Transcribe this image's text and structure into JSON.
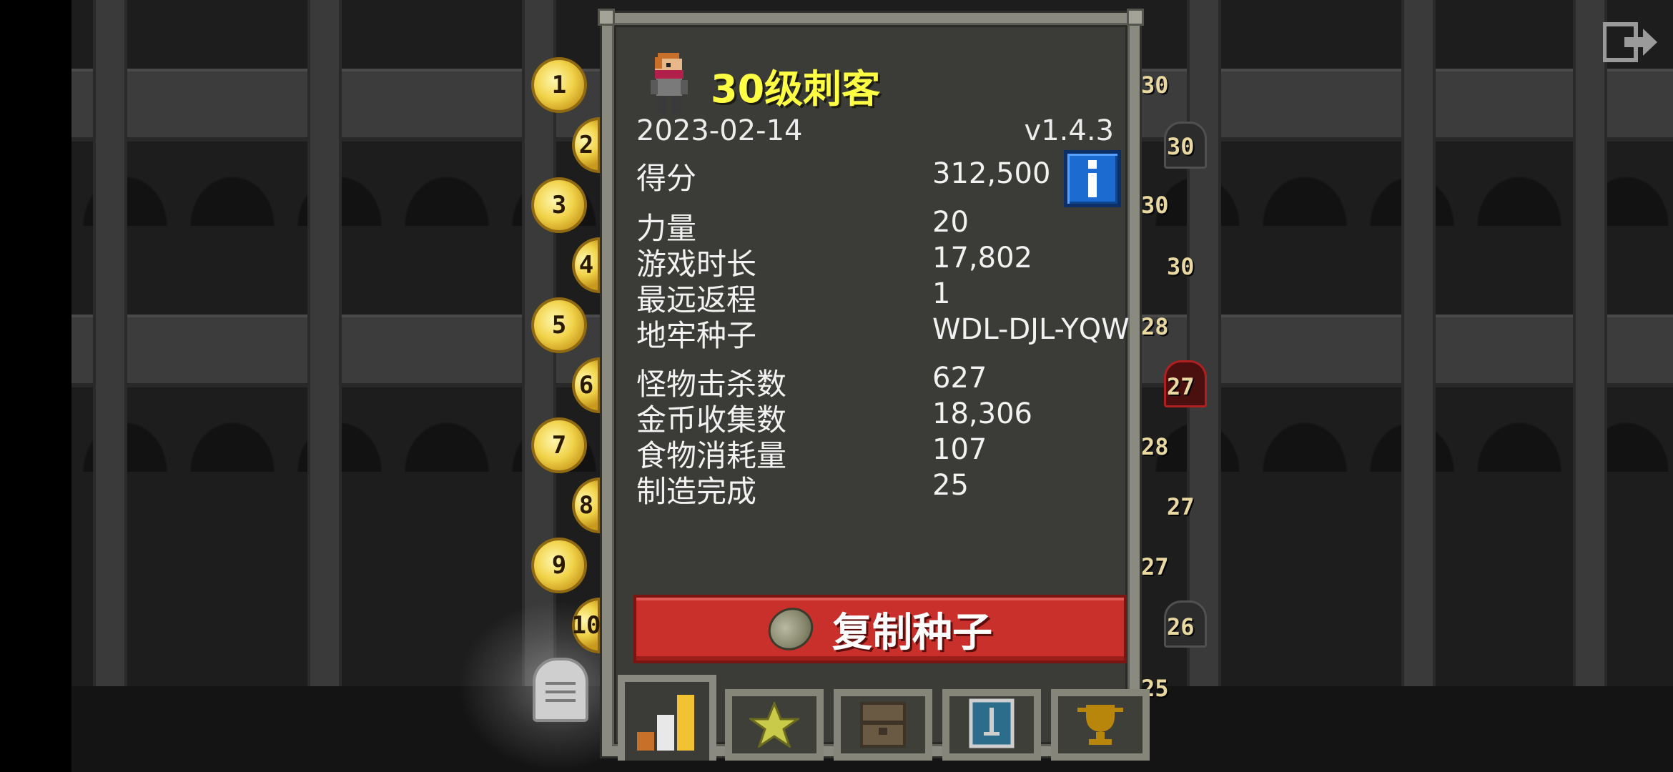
{
  "dialog": {
    "title": "30级刺客",
    "date": "2023-02-14",
    "version": "v1.4.3",
    "stats": [
      {
        "label": "得分",
        "value": "312,500"
      },
      {
        "label": "力量",
        "value": "20"
      },
      {
        "label": "游戏时长",
        "value": "17,802"
      },
      {
        "label": "最远返程",
        "value": "1"
      },
      {
        "label": "地牢种子",
        "value": "WDL-DJL-YQW"
      },
      {
        "label": "怪物击杀数",
        "value": "627"
      },
      {
        "label": "金币收集数",
        "value": "18,306"
      },
      {
        "label": "食物消耗量",
        "value": "107"
      },
      {
        "label": "制造完成",
        "value": "25"
      }
    ],
    "copy_seed_button": "复制种子",
    "info_button_icon": "info-icon",
    "tabs": [
      {
        "icon": "stats-bars-icon",
        "active": true
      },
      {
        "icon": "star-icon",
        "active": false
      },
      {
        "icon": "backpack-icon",
        "active": false
      },
      {
        "icon": "sword-badge-icon",
        "active": false
      },
      {
        "icon": "trophy-icon",
        "active": false
      }
    ]
  },
  "rankings": {
    "badges": [
      "1",
      "2",
      "3",
      "4",
      "5",
      "6",
      "7",
      "8",
      "9",
      "10"
    ],
    "levels": [
      "30",
      "30",
      "30",
      "30",
      "28",
      "27",
      "28",
      "27",
      "27",
      "26",
      "25"
    ]
  },
  "colors": {
    "title": "#ffff44",
    "copy_button": "#c9302b",
    "info_button": "#1c6bd1",
    "badge_gold": "#f1d34a"
  }
}
